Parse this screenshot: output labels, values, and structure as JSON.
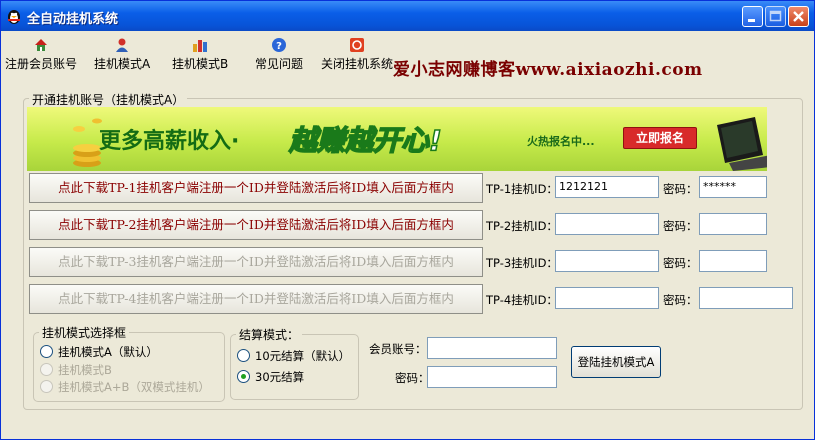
{
  "window": {
    "title": "全自动挂机系统"
  },
  "toolbar": {
    "items": [
      {
        "label": "注册会员账号",
        "icon": "house-icon"
      },
      {
        "label": "挂机模式A",
        "icon": "user-icon"
      },
      {
        "label": "挂机模式B",
        "icon": "bar-chart-icon"
      },
      {
        "label": "常见问题",
        "icon": "help-icon"
      },
      {
        "label": "关闭挂机系统",
        "icon": "power-icon"
      }
    ]
  },
  "blog_banner": "爱小志网赚博客www.aixiaozhi.com",
  "main_group": {
    "legend": "开通挂机账号（挂机模式A）"
  },
  "ad_banner": {
    "slogan1": "更多高薪收入·",
    "slogan2": "越赚越开心!",
    "hot": "火热报名中...",
    "button": "立即报名"
  },
  "rows": [
    {
      "download": "点此下载TP-1挂机客户端注册一个ID并登陆激活后将ID填入后面方框内",
      "id_label": "TP-1挂机ID：",
      "id_value": "1212121",
      "pwd_label": "密码：",
      "pwd_value": "******",
      "enabled": true
    },
    {
      "download": "点此下载TP-2挂机客户端注册一个ID并登陆激活后将ID填入后面方框内",
      "id_label": "TP-2挂机ID：",
      "id_value": "",
      "pwd_label": "密码：",
      "pwd_value": "",
      "enabled": true
    },
    {
      "download": "点此下载TP-3挂机客户端注册一个ID并登陆激活后将ID填入后面方框内",
      "id_label": "TP-3挂机ID：",
      "id_value": "",
      "pwd_label": "密码：",
      "pwd_value": "",
      "enabled": false
    },
    {
      "download": "点此下载TP-4挂机客户端注册一个ID并登陆激活后将ID填入后面方框内",
      "id_label": "TP-4挂机ID：",
      "id_value": "",
      "pwd_label": "密码：",
      "pwd_value": "",
      "enabled": false
    }
  ],
  "mode_group": {
    "legend": "挂机模式选择框",
    "options": [
      {
        "label": "挂机模式A（默认）",
        "enabled": true,
        "checked": false
      },
      {
        "label": "挂机模式B",
        "enabled": false,
        "checked": false
      },
      {
        "label": "挂机模式A+B（双模式挂机）",
        "enabled": false,
        "checked": false
      }
    ]
  },
  "settle_group": {
    "legend": "结算模式：",
    "options": [
      {
        "label": "10元结算（默认）",
        "checked": false
      },
      {
        "label": "30元结算",
        "checked": true
      }
    ]
  },
  "login": {
    "account_label": "会员账号：",
    "account_value": "",
    "password_label": "密码：",
    "password_value": "",
    "button": "登陆挂机模式A"
  },
  "colors": {
    "title_bar": "#0a5ee8",
    "window_bg": "#ece9d8",
    "blog_text": "#7a0000",
    "download_active_text": "#8a0000",
    "radio_check": "#21a121",
    "banner_green": "#c6ea4a"
  }
}
